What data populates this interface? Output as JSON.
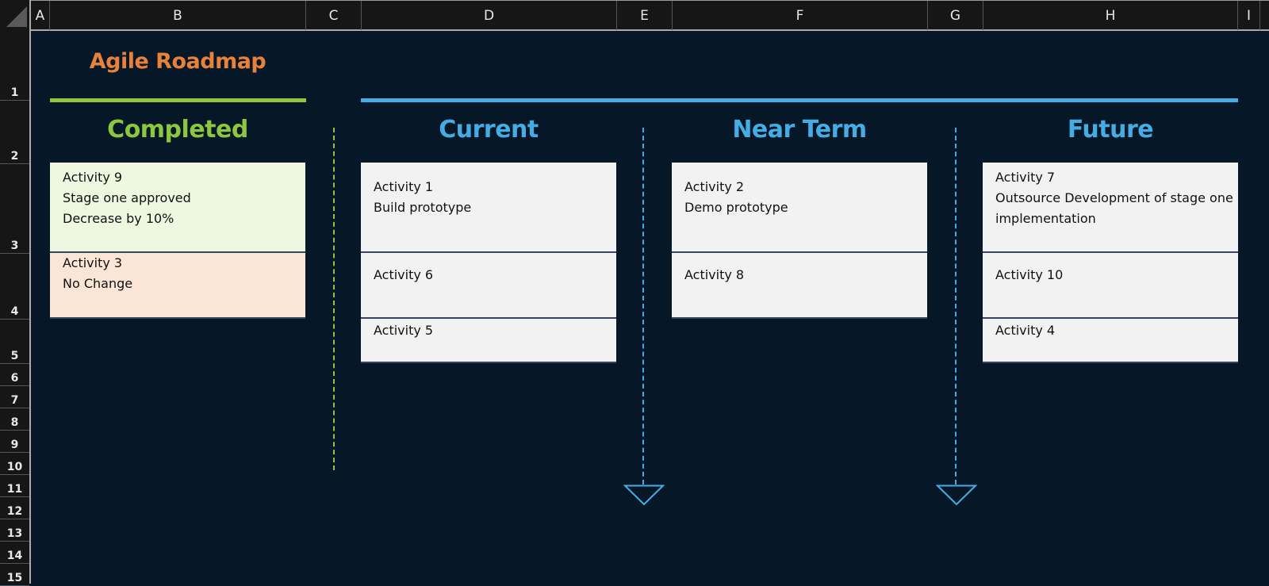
{
  "spreadsheet": {
    "column_headers": [
      "A",
      "B",
      "C",
      "D",
      "E",
      "F",
      "G",
      "H",
      "I"
    ],
    "row_headers": [
      "1",
      "2",
      "3",
      "4",
      "5",
      "6",
      "7",
      "8",
      "9",
      "10",
      "11",
      "12",
      "13",
      "14",
      "15"
    ],
    "select_all_icon": "select-all-triangle-icon"
  },
  "roadmap": {
    "title": "Agile Roadmap",
    "colors": {
      "background": "#061727",
      "title": "#e8823a",
      "completed_accent": "#8dc63f",
      "active_accent": "#45ade3",
      "card_default": "#f2f2f2",
      "card_completed_positive": "#eef8e0",
      "card_completed_neutral": "#fbe5d6"
    },
    "columns": [
      {
        "heading": "Completed",
        "cards": [
          {
            "lines": [
              "Activity 9",
              "Stage one approved",
              "Decrease by 10%"
            ],
            "status": "positive"
          },
          {
            "lines": [
              "Activity 3",
              "No Change"
            ],
            "status": "neutral"
          }
        ]
      },
      {
        "heading": "Current",
        "cards": [
          {
            "lines": [
              "Activity 1",
              "Build prototype"
            ]
          },
          {
            "lines": [
              "Activity 6"
            ]
          },
          {
            "lines": [
              "Activity 5"
            ]
          }
        ]
      },
      {
        "heading": "Near Term",
        "cards": [
          {
            "lines": [
              "Activity 2",
              "Demo prototype"
            ]
          },
          {
            "lines": [
              "Activity 8"
            ]
          }
        ]
      },
      {
        "heading": "Future",
        "cards": [
          {
            "lines": [
              "Activity 7",
              "Outsource Development of stage one",
              "implementation"
            ]
          },
          {
            "lines": [
              "Activity 10"
            ]
          },
          {
            "lines": [
              "Activity 4"
            ]
          }
        ]
      }
    ]
  }
}
